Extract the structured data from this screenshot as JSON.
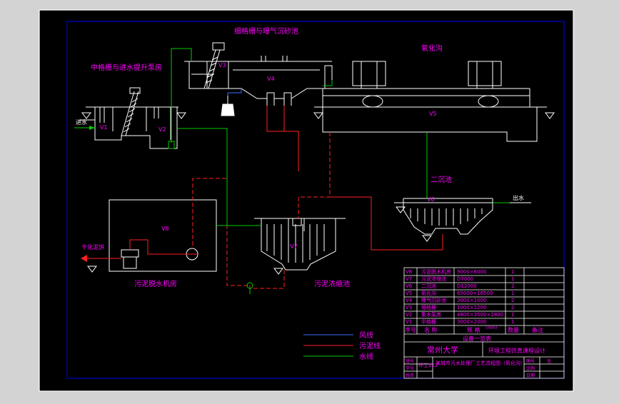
{
  "colors": {
    "viewport": "#d3d3d3",
    "background": "#000000",
    "frame": "#ffffff",
    "inner_frame": "#0000ff",
    "label": "#ff00ff",
    "structure": "#ffffff",
    "air_line": "#3a6fff",
    "sludge_line": "#ff2020",
    "water_line": "#00cc00",
    "table_text": "#ff00ff"
  },
  "labels": {
    "fine_screen": "细格栅与曝气沉砂池",
    "mid_screen": "中格栅与进水提升泵房",
    "oxidation_ditch": "氧化沟",
    "secondary_clarifier": "二沉池",
    "dewatering_room": "污泥脱水机房",
    "thickener": "污泥浓缩池",
    "inflow": "进水",
    "outflow": "出水",
    "sludge_out": "干化泥饼"
  },
  "unit_ids": {
    "v1": "V1",
    "v2": "V2",
    "v3": "V3",
    "v4": "V4",
    "v5": "V5",
    "v6": "V6",
    "v7": "V7",
    "v8": "V8"
  },
  "legend": {
    "air": "风线",
    "sludge": "污泥线",
    "water": "水线"
  },
  "equipment_table": {
    "rows": [
      [
        "V8",
        "污泥脱水机房",
        "9000×6000",
        "1"
      ],
      [
        "V7",
        "污泥浓缩池",
        "D7000",
        "1"
      ],
      [
        "V6",
        "二沉池",
        "D12000",
        "2"
      ],
      [
        "V5",
        "氧化沟",
        "65000×16500",
        "1"
      ],
      [
        "V4",
        "曝气沉砂池",
        "3000×1000",
        "2"
      ],
      [
        "V3",
        "细格栅",
        "1000×1200",
        "2"
      ],
      [
        "V2",
        "集水泵房",
        "4800×3500×2800",
        "1"
      ],
      [
        "V1",
        "中格栅",
        "3000×2000",
        "1"
      ]
    ],
    "header": [
      "序号",
      "名  称",
      "规  格",
      "数量",
      "备注"
    ],
    "unit_note": "(mm)",
    "caption": "设备一览表"
  },
  "title_block": {
    "school": "常州大学",
    "course": "环境工程仿真课程设计",
    "drawing_title": "某城市污水处理厂工艺流程图（氧化沟）",
    "class_label": "环工122",
    "row_labels": [
      "班号",
      "学号",
      "姓名"
    ],
    "right_labels": [
      "图号",
      "比例",
      "日期"
    ],
    "scale": "无"
  }
}
